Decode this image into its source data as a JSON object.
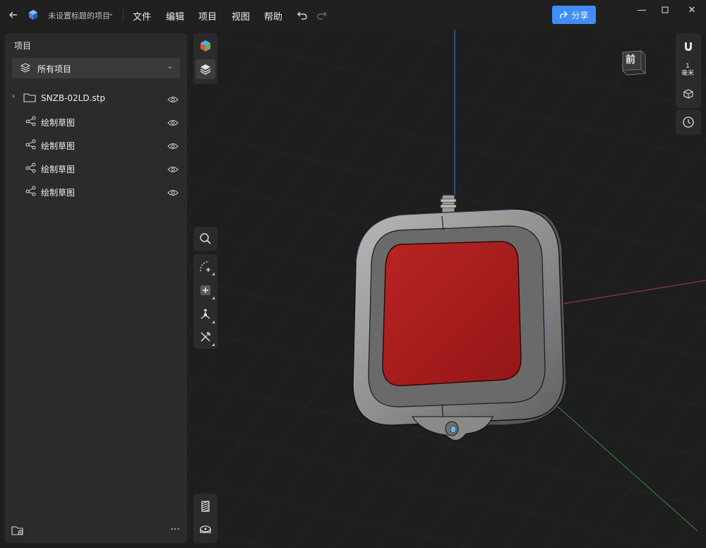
{
  "titlebar": {
    "document_title": "未设置标题的项目",
    "menu": [
      "文件",
      "编辑",
      "项目",
      "视图",
      "帮助"
    ],
    "share_label": "分享"
  },
  "panel": {
    "title": "项目",
    "filter_label": "所有项目",
    "tree": [
      {
        "label": "SNZB-02LD.stp",
        "icon": "folder-icon",
        "expandable": true
      },
      {
        "label": "绘制草图",
        "icon": "sketch-icon",
        "expandable": false
      },
      {
        "label": "绘制草图",
        "icon": "sketch-icon",
        "expandable": false
      },
      {
        "label": "绘制草图",
        "icon": "sketch-icon",
        "expandable": false
      },
      {
        "label": "绘制草图",
        "icon": "sketch-icon",
        "expandable": false
      }
    ]
  },
  "viewport": {
    "scale_value": "1",
    "scale_unit": "毫米",
    "view_cube_face": "前",
    "model_face_color": "#a81d1d",
    "axis_colors": {
      "x": "#b33a3a",
      "y": "#3b8a3b",
      "z": "#3a6fd0"
    }
  },
  "colors": {
    "accent": "#3f8ef5",
    "panel_bg": "#2b2b2b",
    "titlebar_bg": "#202020",
    "viewport_bg": "#1e1e1e"
  }
}
